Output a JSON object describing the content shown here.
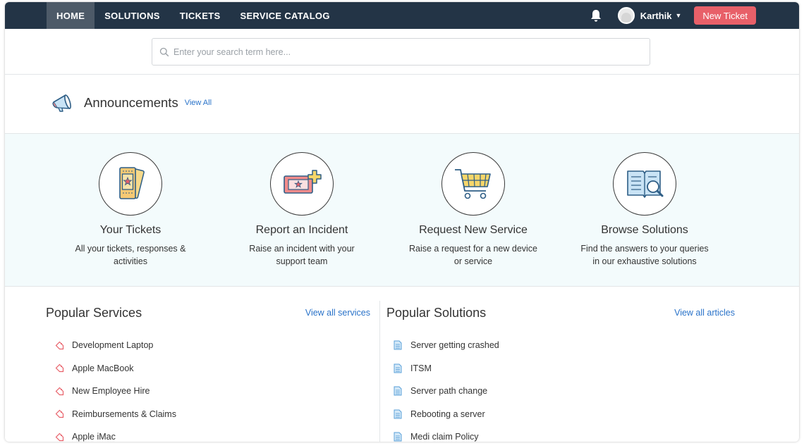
{
  "nav": {
    "items": [
      {
        "label": "HOME",
        "active": true
      },
      {
        "label": "SOLUTIONS",
        "active": false
      },
      {
        "label": "TICKETS",
        "active": false
      },
      {
        "label": "SERVICE CATALOG",
        "active": false
      }
    ],
    "user_name": "Karthik",
    "new_ticket_label": "New Ticket",
    "icons": {
      "bell": "bell-icon",
      "caret": "caret-down-icon"
    }
  },
  "search": {
    "placeholder": "Enter your search term here...",
    "icon": "search-icon"
  },
  "announcements": {
    "title": "Announcements",
    "view_all_label": "View All",
    "icon": "megaphone-icon"
  },
  "tiles": [
    {
      "title": "Your Tickets",
      "description": "All your tickets, responses & activities",
      "icon": "tickets-icon"
    },
    {
      "title": "Report an Incident",
      "description": "Raise an incident with your support team",
      "icon": "incident-ticket-icon"
    },
    {
      "title": "Request New Service",
      "description": "Raise a request for a new device or service",
      "icon": "shopping-cart-icon"
    },
    {
      "title": "Browse Solutions",
      "description": "Find the answers to your queries in our exhaustive solutions",
      "icon": "book-search-icon"
    }
  ],
  "popular_services": {
    "title": "Popular Services",
    "view_all_label": "View all services",
    "item_icon": "tag-icon",
    "items": [
      "Development Laptop",
      "Apple MacBook",
      "New Employee Hire",
      "Reimbursements & Claims",
      "Apple iMac"
    ]
  },
  "popular_solutions": {
    "title": "Popular Solutions",
    "view_all_label": "View all articles",
    "item_icon": "document-icon",
    "items": [
      "Server getting crashed",
      "ITSM",
      "Server path change",
      "Rebooting a server",
      "Medi claim Policy"
    ]
  },
  "colors": {
    "nav_bg": "#233446",
    "nav_active": "#4d5a68",
    "accent_red": "#e86069",
    "link_blue": "#2a73c9",
    "tiles_bg": "#f3fbfc"
  }
}
